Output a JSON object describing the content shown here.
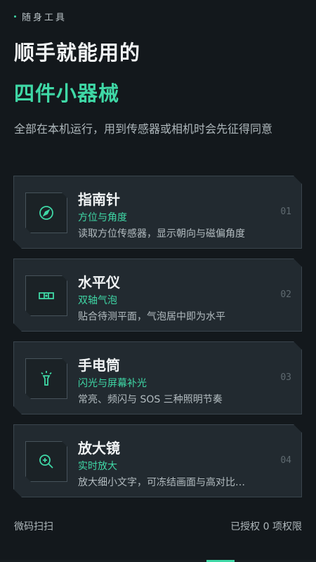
{
  "header": {
    "eyebrow": "随身工具",
    "title_line1": "顺手就能用的",
    "title_line2": "四件小器械",
    "subtitle": "全部在本机运行，用到传感器或相机时会先征得同意"
  },
  "tools": [
    {
      "title": "指南针",
      "tag": "方位与角度",
      "desc": "读取方位传感器，显示朝向与磁偏角度",
      "num": "01",
      "icon": "compass-icon"
    },
    {
      "title": "水平仪",
      "tag": "双轴气泡",
      "desc": "贴合待测平面，气泡居中即为水平",
      "num": "02",
      "icon": "level-icon"
    },
    {
      "title": "手电筒",
      "tag": "闪光与屏幕补光",
      "desc": "常亮、频闪与 SOS 三种照明节奏",
      "num": "03",
      "icon": "flashlight-icon"
    },
    {
      "title": "放大镜",
      "tag": "实时放大",
      "desc": "放大细小文字，可冻结画面与高对比…",
      "num": "04",
      "icon": "magnifier-icon"
    }
  ],
  "footer": {
    "left": "微码扫扫",
    "right": "已授权 0 项权限"
  },
  "colors": {
    "accent": "#3fd8a6",
    "background": "#13181c",
    "card": "#222a30"
  }
}
